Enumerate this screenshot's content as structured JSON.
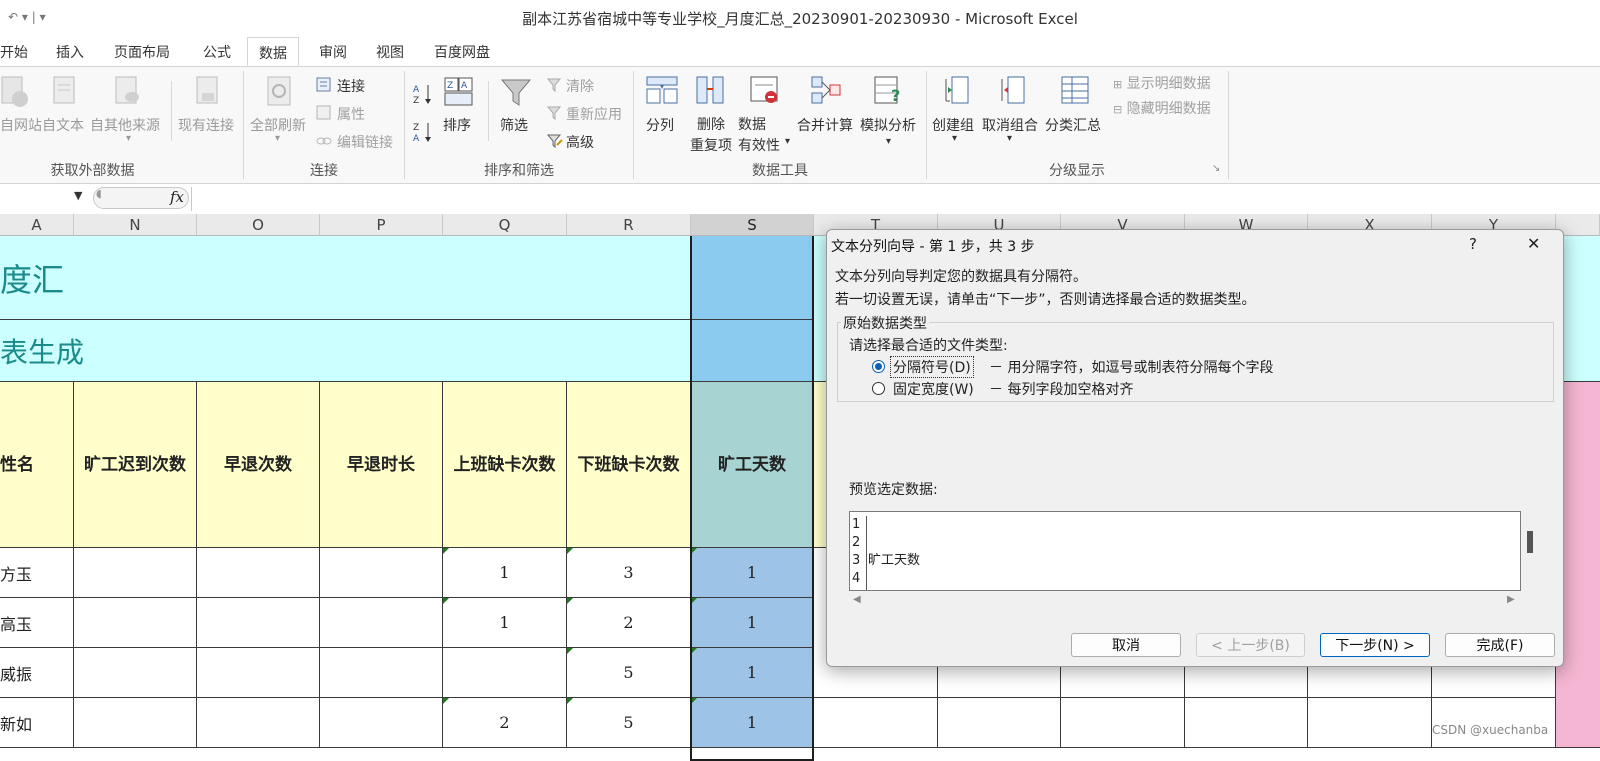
{
  "window": {
    "title": "副本江苏省宿城中等专业学校_月度汇总_20230901-20230930  -  Microsoft Excel",
    "qat": "↶ ▾ |  ▾"
  },
  "tabs": [
    "开始",
    "插入",
    "页面布局",
    "公式",
    "数据",
    "审阅",
    "视图",
    "百度网盘"
  ],
  "ribbon": {
    "get_external": {
      "buttons": [
        "自网站",
        "自文本",
        "自其他来源",
        "现有连接"
      ],
      "label": "获取外部数据"
    },
    "connections": {
      "refresh": "全部刷新",
      "items": [
        "连接",
        "属性",
        "编辑链接"
      ],
      "label": "连接"
    },
    "sort_filter": {
      "sort": "排序",
      "filter": "筛选",
      "items": [
        "清除",
        "重新应用",
        "高级"
      ],
      "label": "排序和筛选"
    },
    "data_tools": {
      "split": "分列",
      "remove_dup": "删除\n重复项",
      "validation": "数据\n有效性",
      "consolidate": "合并计算",
      "whatif": "模拟分析",
      "label": "数据工具"
    },
    "outline": {
      "group": "创建组",
      "ungroup": "取消组合",
      "subtotal": "分类汇总",
      "show_detail": "显示明细数据",
      "hide_detail": "隐藏明细数据",
      "label": "分级显示"
    }
  },
  "formula_bar": {
    "fx": "fx",
    "name_box": ""
  },
  "columns": [
    "A",
    "N",
    "O",
    "P",
    "Q",
    "R",
    "S",
    "T",
    "U",
    "V",
    "W",
    "X",
    "Y"
  ],
  "sheet": {
    "title_fragment": "度汇",
    "subtitle_fragment": "表生成",
    "headers": [
      "性名",
      "旷工迟到次数",
      "早退次数",
      "早退时长",
      "上班缺卡次数",
      "下班缺卡次数",
      "旷工天数"
    ],
    "rows": [
      {
        "name": "方玉",
        "n": "",
        "o": "",
        "p": "",
        "q": "1",
        "r": "3",
        "s": "1"
      },
      {
        "name": "高玉",
        "n": "",
        "o": "",
        "p": "",
        "q": "1",
        "r": "2",
        "s": "1"
      },
      {
        "name": "威振",
        "n": "",
        "o": "",
        "p": "",
        "q": "",
        "r": "5",
        "s": "1"
      },
      {
        "name": "新如",
        "n": "",
        "o": "",
        "p": "",
        "q": "2",
        "r": "5",
        "s": "1"
      }
    ]
  },
  "dialog": {
    "title": "文本分列向导 - 第 1 步，共 3 步",
    "help": "?",
    "close": "✕",
    "line1": "文本分列向导判定您的数据具有分隔符。",
    "line2": "若一切设置无误，请单击“下一步”，否则请选择最合适的数据类型。",
    "group_title": "原始数据类型",
    "prompt": "请选择最合适的文件类型:",
    "opt1": "分隔符号(D)",
    "opt1_desc": "－ 用分隔字符，如逗号或制表符分隔每个字段",
    "opt2": "固定宽度(W)",
    "opt2_desc": "－ 每列字段加空格对齐",
    "preview_label": "预览选定数据:",
    "preview_rows": [
      {
        "num": "1",
        "text": ""
      },
      {
        "num": "2",
        "text": ""
      },
      {
        "num": "3",
        "text": "旷工天数"
      },
      {
        "num": "4",
        "text": ""
      }
    ],
    "buttons": {
      "cancel": "取消",
      "back": "< 上一步(B)",
      "next": "下一步(N) >",
      "finish": "完成(F)"
    }
  },
  "watermark": "CSDN @xuechanba",
  "colors": {
    "accent": "#217346",
    "sheet_cyan": "#ccffff",
    "sheet_yellow": "#ffffcc",
    "selected_col": "#9dc3e6"
  }
}
